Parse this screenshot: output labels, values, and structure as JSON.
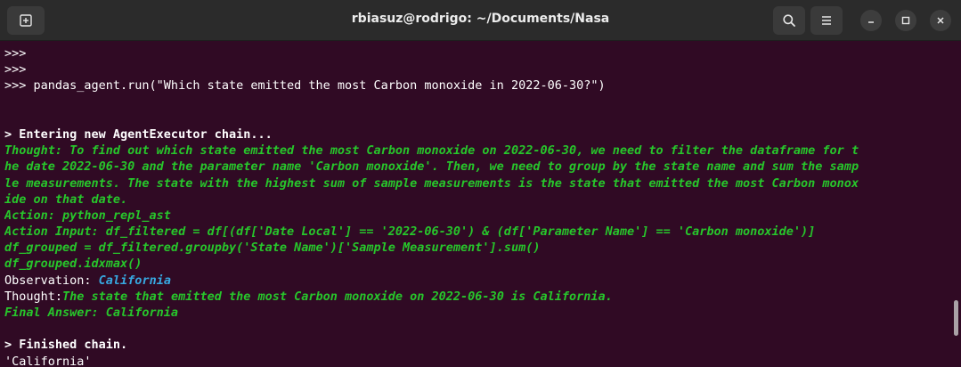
{
  "window": {
    "title": "rbiasuz@rodrigo: ~/Documents/Nasa"
  },
  "colors": {
    "background": "#300a24",
    "titlebar": "#2b2b2b",
    "green_text": "#27c62b",
    "cyan_text": "#37a8e0",
    "default_text": "#ffffff"
  },
  "icons": {
    "new_tab": "new-tab-icon",
    "search": "search-icon",
    "menu": "hamburger-menu-icon",
    "minimize": "minimize-icon",
    "maximize": "maximize-icon",
    "close": "close-icon"
  },
  "terminal": {
    "prompt1": ">>>",
    "prompt2": ">>>",
    "command": ">>> pandas_agent.run(\"Which state emitted the most Carbon monoxide in 2022-06-30?\")",
    "entering": "> Entering new AgentExecutor chain...",
    "thought1_l1": "Thought: To find out which state emitted the most Carbon monoxide on 2022-06-30, we need to filter the dataframe for t",
    "thought1_l2": "he date 2022-06-30 and the parameter name 'Carbon monoxide'. Then, we need to group by the state name and sum the samp",
    "thought1_l3": "le measurements. The state with the highest sum of sample measurements is the state that emitted the most Carbon monox",
    "thought1_l4": "ide on that date.",
    "action": "Action: python_repl_ast",
    "action_input_l1": "Action Input: df_filtered = df[(df['Date Local'] == '2022-06-30') & (df['Parameter Name'] == 'Carbon monoxide')]",
    "action_input_l2": "df_grouped = df_filtered.groupby('State Name')['Sample Measurement'].sum()",
    "action_input_l3": "df_grouped.idxmax()",
    "observation_label": "Observation: ",
    "observation_value": "California",
    "thought2_label": "Thought:",
    "thought2_text": "The state that emitted the most Carbon monoxide on 2022-06-30 is California.",
    "final_answer": "Final Answer: California",
    "finished": "> Finished chain.",
    "result": "'California'"
  }
}
